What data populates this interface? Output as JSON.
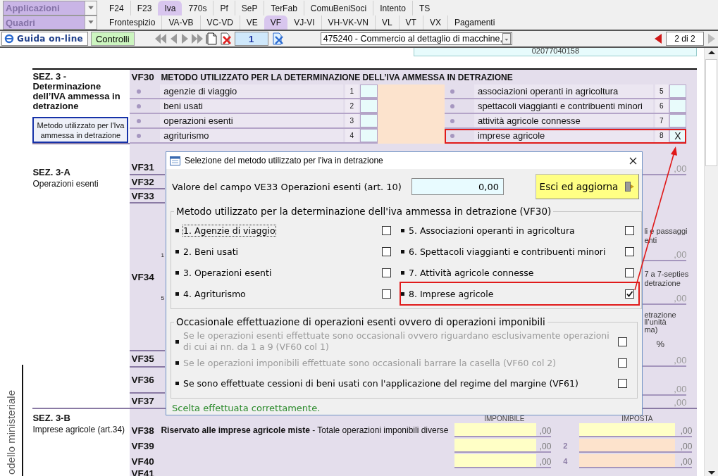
{
  "app_menu": "Applicazioni",
  "app_tabs": [
    {
      "label": "F24",
      "selected": false
    },
    {
      "label": "F23",
      "selected": false
    },
    {
      "label": "Iva",
      "selected": true
    },
    {
      "label": "770s",
      "selected": false
    },
    {
      "label": "Pf",
      "selected": false
    },
    {
      "label": "SeP",
      "selected": false
    },
    {
      "label": "TerFab",
      "selected": false
    },
    {
      "label": "ComuBeniSoci",
      "selected": false
    },
    {
      "label": "Intento",
      "selected": false
    },
    {
      "label": "TS",
      "selected": false
    }
  ],
  "quadri_menu": "Quadri",
  "quadri_tabs": [
    {
      "label": "Frontespizio",
      "selected": false
    },
    {
      "label": "VA-VB",
      "selected": false
    },
    {
      "label": "VC-VD",
      "selected": false
    },
    {
      "label": "VE",
      "selected": false
    },
    {
      "label": "VF",
      "selected": true
    },
    {
      "label": "VJ-VI",
      "selected": false
    },
    {
      "label": "VH-VK-VN",
      "selected": false
    },
    {
      "label": "VL",
      "selected": false
    },
    {
      "label": "VT",
      "selected": false
    },
    {
      "label": "VX",
      "selected": false
    },
    {
      "label": "Pagamenti",
      "selected": false
    }
  ],
  "toolbar": {
    "help_button": "Guida on-line",
    "check_button": "Controlli",
    "page_field": "1",
    "activity_select": "475240 - Commercio al dettaglio di macchine,",
    "page_counter": "2 di 2"
  },
  "fiscal_code": "02077040158",
  "section_3": {
    "title": "SEZ. 3 - Determinazione dell’IVA ammessa in detrazione",
    "method_button": "Metodo utilizzato per l'Iva ammessa in detrazione",
    "code": "VF30",
    "heading": "METODO UTILIZZATO PER LA DETERMINAZIONE DELL’IVA AMMESSA IN DETRAZIONE",
    "options": [
      {
        "label": "agenzie di viaggio",
        "number": "1",
        "highlighted": false
      },
      {
        "label": "beni usati",
        "number": "2",
        "highlighted": false
      },
      {
        "label": "operazioni esenti",
        "number": "3",
        "highlighted": false
      },
      {
        "label": "agriturismo",
        "number": "4",
        "highlighted": false
      },
      {
        "label": "associazioni operanti in agricoltura",
        "number": "5",
        "highlighted": false
      },
      {
        "label": "spettacoli viaggianti e contribuenti minori",
        "number": "6",
        "highlighted": false
      },
      {
        "label": "attività agricole connesse",
        "number": "7",
        "highlighted": false
      },
      {
        "label": "imprese agricole",
        "number": "8",
        "value": "X",
        "highlighted": true
      }
    ]
  },
  "section_3a": {
    "title": "SEZ. 3-A",
    "subtitle": "Operazioni esenti",
    "codes": [
      {
        "code": "VF31"
      },
      {
        "code": "VF32"
      },
      {
        "code": "VF33"
      },
      {
        "code": "VF34",
        "numbers": [
          "1",
          "5"
        ]
      },
      {
        "code": "VF35"
      },
      {
        "code": "VF36"
      },
      {
        "code": "VF37"
      }
    ],
    "fragments": [
      {
        "kind": "amount",
        "text": ",00"
      },
      {
        "kind": "note",
        "text": "li e passaggi"
      },
      {
        "kind": "note",
        "text": "enti"
      },
      {
        "kind": "amount",
        "text": ",00"
      },
      {
        "kind": "note",
        "text": "7 a 7-septies"
      },
      {
        "kind": "note",
        "text": "detrazione"
      },
      {
        "kind": "amount",
        "text": ",00"
      },
      {
        "kind": "note",
        "text": "etrazione"
      },
      {
        "kind": "note",
        "text": "ll’unità"
      },
      {
        "kind": "note",
        "text": "ma)"
      },
      {
        "kind": "unit",
        "text": "%"
      },
      {
        "kind": "amount",
        "text": ",00"
      },
      {
        "kind": "amount",
        "text": ",00"
      },
      {
        "kind": "amount",
        "text": ",00"
      }
    ]
  },
  "section_3b": {
    "title": "SEZ. 3-B",
    "subtitle": "Imprese agricole (art.34)",
    "column_headers": [
      "IMPONIBILE",
      "IMPOSTA"
    ],
    "rows": [
      {
        "code": "VF38",
        "text": "**Riservato alle imprese agricole miste** - Totale operazioni imponibili diverse",
        "fields": [
          {
            "kind": "input",
            "text": ",00"
          },
          {
            "kind": "input",
            "text": ",00"
          }
        ]
      },
      {
        "code": "VF39",
        "number": "2",
        "fields": [
          {
            "kind": "input",
            "text": ",00"
          },
          {
            "kind": "computed",
            "text": ",00"
          }
        ]
      },
      {
        "code": "VF40",
        "number": "4",
        "fields": [
          {
            "kind": "input",
            "text": ",00"
          },
          {
            "kind": "computed",
            "text": ",00"
          }
        ]
      },
      {
        "code": "VF41"
      }
    ]
  },
  "side_label": "odello ministeriale",
  "dialog": {
    "title": "Selezione del metodo utilizzato per l'iva in detrazione",
    "value_label": "Valore del campo VE33 Operazioni esenti (art. 10)",
    "value": "0,00",
    "exit_button": "Esci ed aggiorna",
    "method_legend": "Metodo utilizzato per la determinazione dell'iva ammessa in detrazione (VF30)",
    "method_options": [
      {
        "label": "1. Agenzie di viaggio",
        "checked": false,
        "focused": true,
        "highlighted": false
      },
      {
        "label": "2. Beni usati",
        "checked": false,
        "focused": false,
        "highlighted": false
      },
      {
        "label": "3. Operazioni esenti",
        "checked": false,
        "focused": false,
        "highlighted": false
      },
      {
        "label": "4. Agriturismo",
        "checked": false,
        "focused": false,
        "highlighted": false
      },
      {
        "label": "5. Associazioni operanti in agricoltura",
        "checked": false,
        "focused": false,
        "highlighted": false
      },
      {
        "label": "6. Spettacoli viaggianti e contribuenti minori",
        "checked": false,
        "focused": false,
        "highlighted": false
      },
      {
        "label": "7. Attività agricole connesse",
        "checked": false,
        "focused": false,
        "highlighted": false
      },
      {
        "label": "8. Imprese agricole",
        "checked": true,
        "focused": false,
        "highlighted": true
      }
    ],
    "occasional_legend": "Occasionale effettuazione di operazioni esenti ovvero di operazioni imponibili",
    "occasional_options": [
      {
        "label": "Se le operazioni esenti effettuate sono occasionali ovvero riguardano esclusivamente operazioni di cui ai nn. da 1 a 9 (VF60 col 1)",
        "checked": false,
        "disabled": true
      },
      {
        "label": "Se le operazioni imponibili effettuate sono occasionali barrare la casella (VF60 col 2)",
        "checked": false,
        "disabled": true
      },
      {
        "label": "Se sono effettuate cessioni di beni usati con l'applicazione del regime del margine (VF61)",
        "checked": false,
        "disabled": false
      }
    ],
    "status": "Scelta effettuata correttamente."
  }
}
